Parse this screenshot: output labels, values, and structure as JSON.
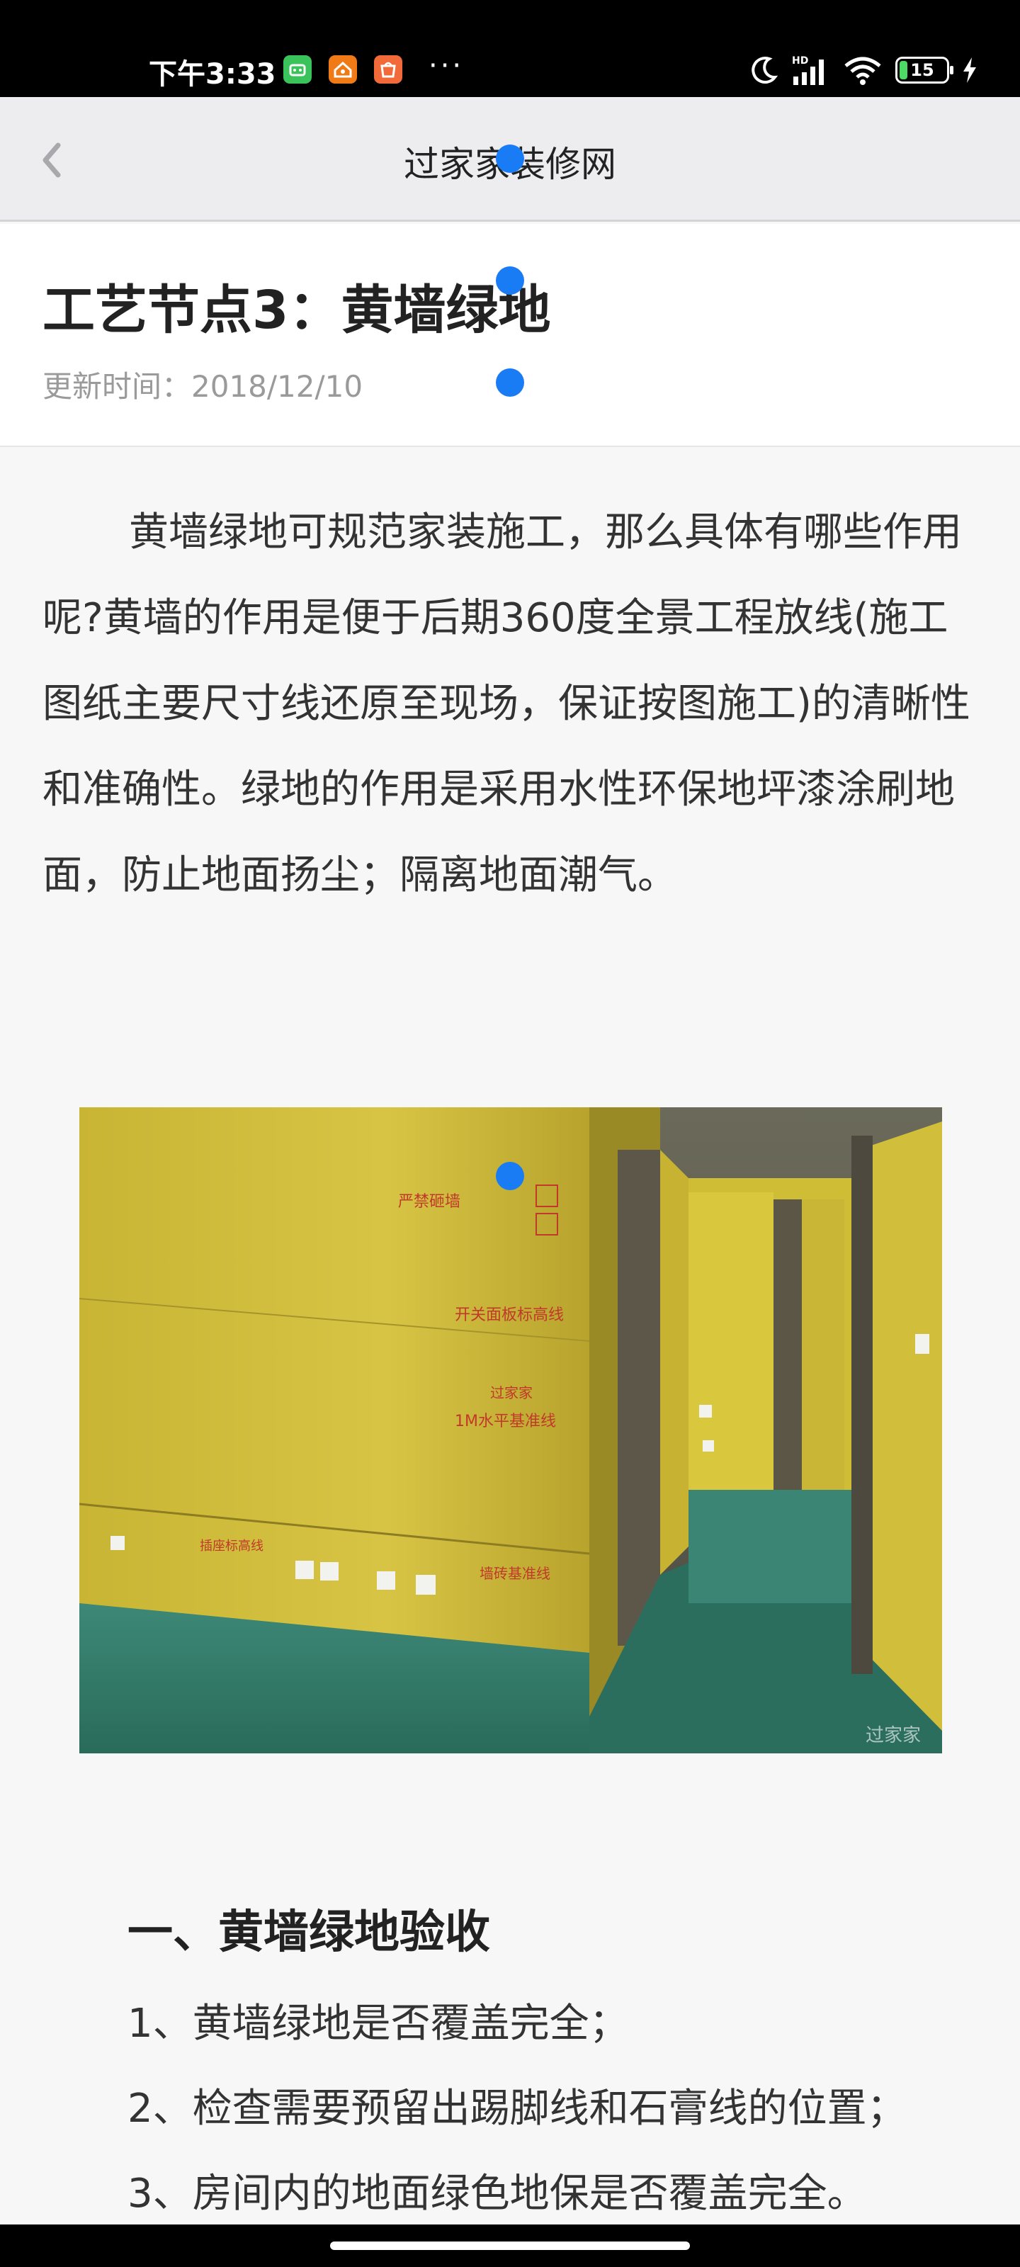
{
  "status_bar": {
    "time": "下午3:33",
    "more": "···",
    "signal_label": "HD",
    "battery": "15",
    "battery_level": 0.15
  },
  "header": {
    "back_icon": "chevron-left-icon",
    "title": "过家家装修网"
  },
  "article": {
    "title": "工艺节点3：黄墙绿地",
    "updated": "更新时间：2018/12/10",
    "intro": "黄墙绿地可规范家装施工，那么具体有哪些作用呢?黄墙的作用是便于后期360度全景工程放线(施工图纸主要尺寸线还原至现场，保证按图施工)的清晰性和准确性。绿地的作用是采用水性环保地坪漆涂刷地面，防止地面扬尘；隔离地面潮气。",
    "section_heading": "一、黄墙绿地验收",
    "checks": [
      "1、黄墙绿地是否覆盖完全；",
      "2、检查需要预留出踢脚线和石膏线的位置；",
      "3、房间内的地面绿色地保是否覆盖完全。"
    ]
  },
  "photo_text": {
    "mark_1": "严禁砸墙",
    "mark_2": "开关面板标高线",
    "mark_3": "过家家",
    "mark_4": "1M水平基准线",
    "mark_5": "插座标高线",
    "mark_6": "墙砖基准线",
    "watermark": "过家家"
  },
  "colors": {
    "status_bg": "#000000",
    "nav_bg": "#ededf0",
    "touch_dot": "#1a7cf5",
    "wall_yellow": "#d7c23a",
    "floor_green": "#2f7d6a"
  }
}
